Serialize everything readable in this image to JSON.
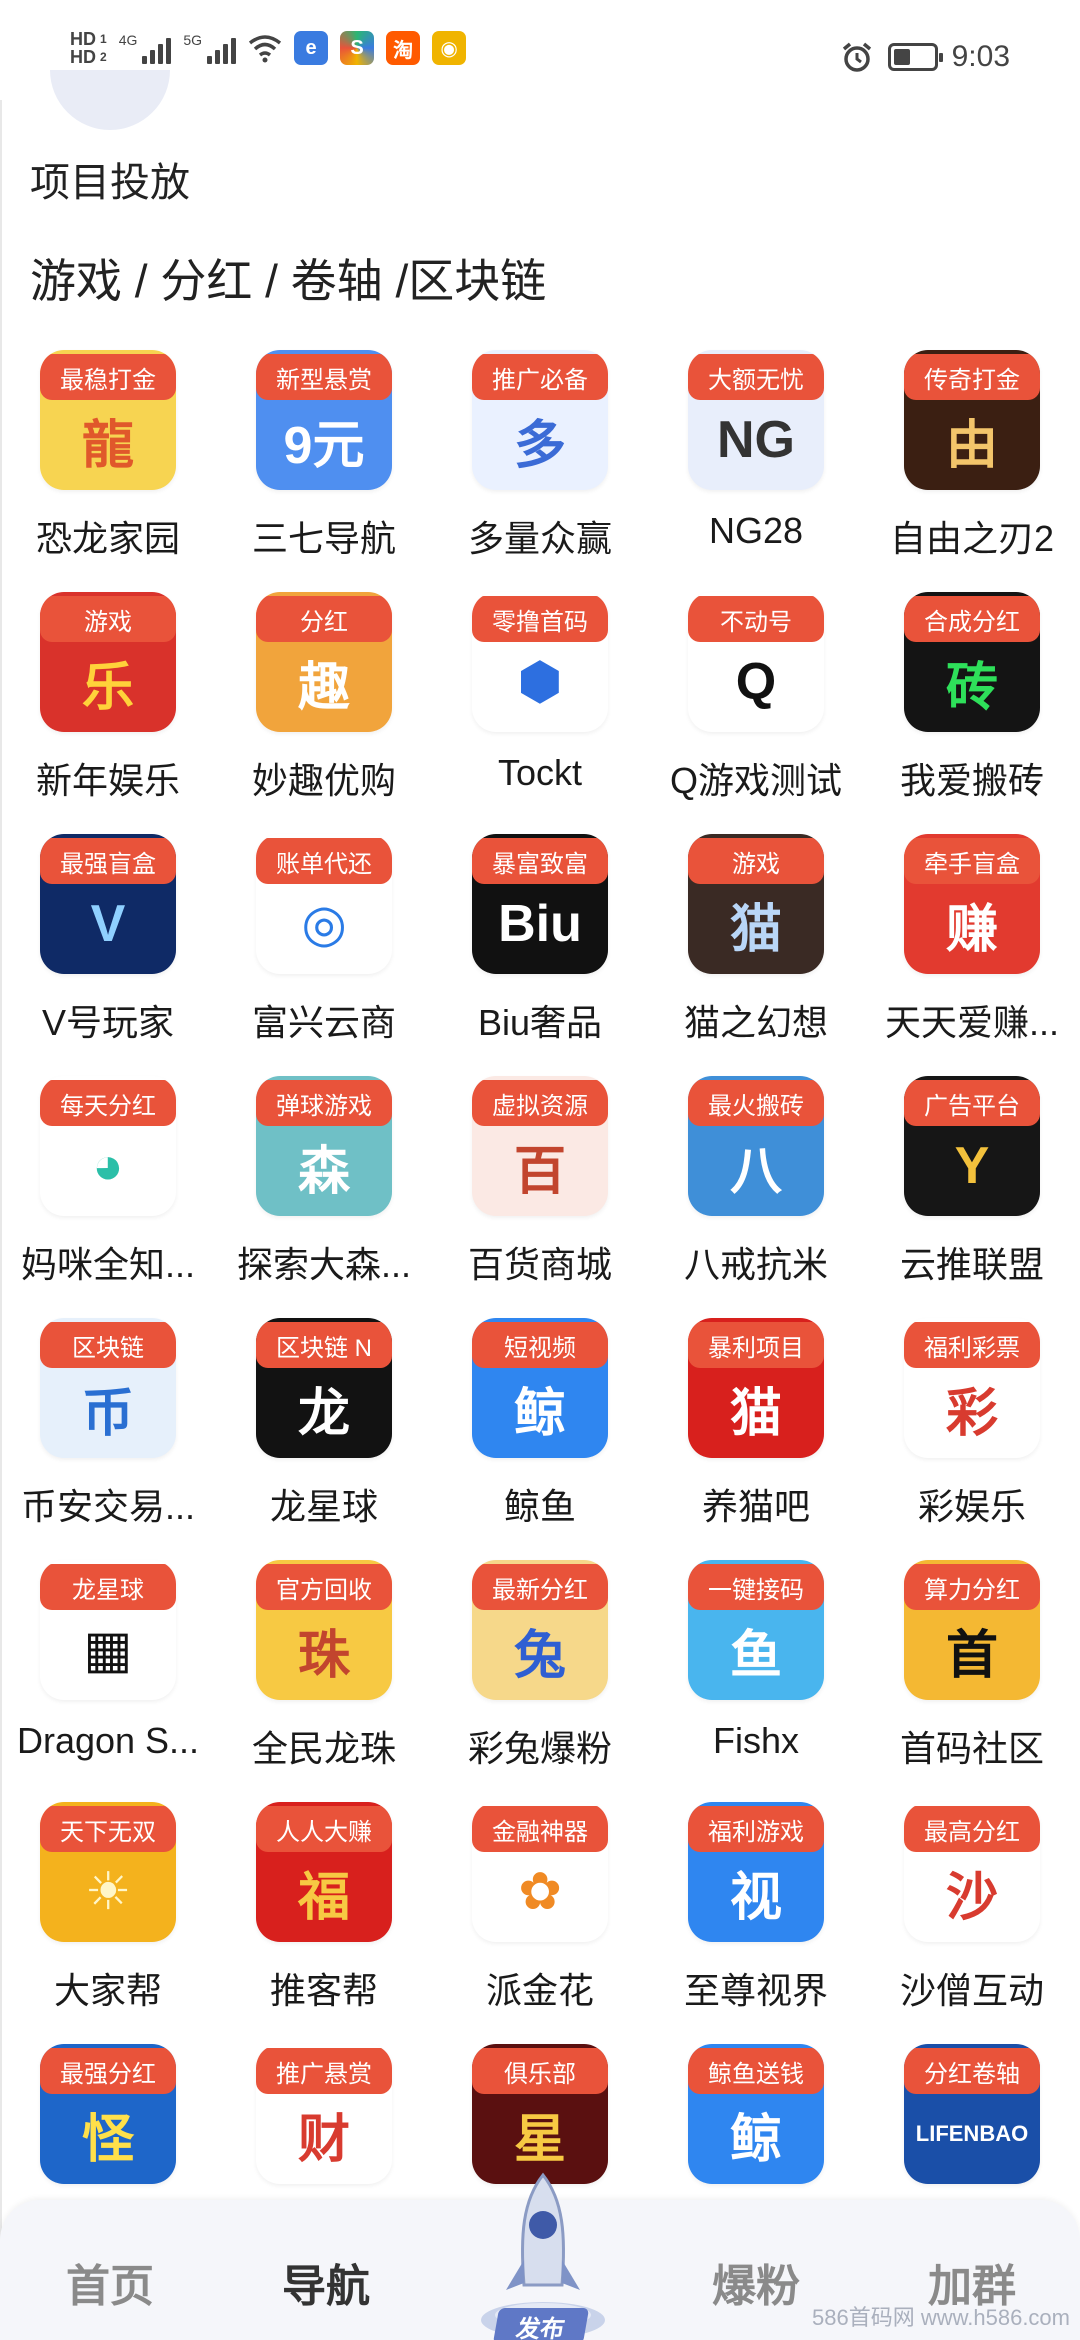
{
  "status_bar": {
    "hd1": "HD",
    "hd2": "HD",
    "net1": "4G",
    "net2": "5G",
    "time": "9:03",
    "apps": [
      {
        "icon": "app-icon-blue",
        "color": "#3a7be0"
      },
      {
        "icon": "app-icon-multicolor",
        "color": "#2bb673"
      },
      {
        "icon": "taobao-icon",
        "text": "淘",
        "color": "#ff5a00"
      },
      {
        "icon": "weibo-icon",
        "color": "#f0b400"
      }
    ]
  },
  "section_title": "项目投放",
  "categories": "游戏 / 分红 / 卷轴 /区块链",
  "items": [
    {
      "badge": "最稳打金",
      "name": "恐龙家园",
      "bg": "#f7d451",
      "fg": "#e0582b",
      "glyph": "龍",
      "icon": "dragon-icon"
    },
    {
      "badge": "新型悬赏",
      "name": "三七导航",
      "bg": "#4f8ff0",
      "fg": "#ffffff",
      "glyph": "9元",
      "icon": "app-icon"
    },
    {
      "badge": "推广必备",
      "name": "多量众赢",
      "bg": "#eaf1ff",
      "fg": "#3b6bd6",
      "glyph": "多",
      "icon": "app-icon"
    },
    {
      "badge": "大额无忧",
      "name": "NG28",
      "bg": "#e8eefb",
      "fg": "#333333",
      "glyph": "NG",
      "icon": "app-icon"
    },
    {
      "badge": "传奇打金",
      "name": "自由之刃2",
      "bg": "#3b1f12",
      "fg": "#f3c56b",
      "glyph": "由",
      "icon": "app-icon"
    },
    {
      "badge": "游戏",
      "name": "新年娱乐",
      "bg": "#d9322b",
      "fg": "#ffd23a",
      "glyph": "乐",
      "icon": "app-icon"
    },
    {
      "badge": "分红",
      "name": "妙趣优购",
      "bg": "#f1a43c",
      "fg": "#ffffff",
      "glyph": "趣",
      "icon": "app-icon"
    },
    {
      "badge": "零撸首码",
      "name": "Tockt",
      "bg": "#ffffff",
      "fg": "#2d6fe0",
      "glyph": "⬢",
      "icon": "hexagon-icon"
    },
    {
      "badge": "不动号",
      "name": "Q游戏测试",
      "bg": "#ffffff",
      "fg": "#111111",
      "glyph": "Q",
      "icon": "penguin-icon"
    },
    {
      "badge": "合成分红",
      "name": "我爱搬砖",
      "bg": "#141414",
      "fg": "#2ee05a",
      "glyph": "砖",
      "icon": "app-icon"
    },
    {
      "badge": "最强盲盒",
      "name": "V号玩家",
      "bg": "#0f2a66",
      "fg": "#8fd0ff",
      "glyph": "V",
      "icon": "app-icon"
    },
    {
      "badge": "账单代还",
      "name": "富兴云商",
      "bg": "#ffffff",
      "fg": "#2a7be6",
      "glyph": "◎",
      "icon": "app-icon"
    },
    {
      "badge": "暴富致富",
      "name": "Biu奢品",
      "bg": "#111111",
      "fg": "#ffffff",
      "glyph": "Biu",
      "icon": "app-icon"
    },
    {
      "badge": "游戏",
      "name": "猫之幻想",
      "bg": "#3a2a24",
      "fg": "#b9d6f7",
      "glyph": "猫",
      "icon": "cat-icon"
    },
    {
      "badge": "牵手盲盒",
      "name": "天天爱赚...",
      "bg": "#e23a2f",
      "fg": "#ffffff",
      "glyph": "赚",
      "icon": "app-icon"
    },
    {
      "badge": "每天分红",
      "name": "妈咪全知...",
      "bg": "#ffffff",
      "fg": "#2bbfa8",
      "glyph": "◕",
      "icon": "bird-icon"
    },
    {
      "badge": "弹球游戏",
      "name": "探索大森...",
      "bg": "#6fc0c6",
      "fg": "#ffffff",
      "glyph": "森",
      "icon": "app-icon"
    },
    {
      "badge": "虚拟资源",
      "name": "百货商城",
      "bg": "#fbe9e4",
      "fg": "#c2452e",
      "glyph": "百",
      "icon": "app-icon"
    },
    {
      "badge": "最火搬砖",
      "name": "八戒抗米",
      "bg": "#3f8fd8",
      "fg": "#ffffff",
      "glyph": "八",
      "icon": "app-icon"
    },
    {
      "badge": "广告平台",
      "name": "云推联盟",
      "bg": "#161616",
      "fg": "#f3c13c",
      "glyph": "Y",
      "icon": "app-icon"
    },
    {
      "badge": "区块链",
      "name": "币安交易...",
      "bg": "#e6f0fb",
      "fg": "#2a6fd2",
      "glyph": "币",
      "icon": "app-icon"
    },
    {
      "badge": "区块链 N",
      "name": "龙星球",
      "bg": "#121212",
      "fg": "#ffffff",
      "glyph": "龙",
      "icon": "app-icon"
    },
    {
      "badge": "短视频",
      "name": "鲸鱼",
      "bg": "#2f86f0",
      "fg": "#ffffff",
      "glyph": "鲸",
      "icon": "app-icon"
    },
    {
      "badge": "暴利项目",
      "name": "养猫吧",
      "bg": "#d8201d",
      "fg": "#ffffff",
      "glyph": "猫",
      "icon": "cat-icon"
    },
    {
      "badge": "福利彩票",
      "name": "彩娱乐",
      "bg": "#ffffff",
      "fg": "#d83b2f",
      "glyph": "彩",
      "icon": "app-icon"
    },
    {
      "badge": "龙星球",
      "name": "Dragon S...",
      "bg": "#ffffff",
      "fg": "#111111",
      "glyph": "▦",
      "icon": "qr-code-icon"
    },
    {
      "badge": "官方回收",
      "name": "全民龙珠",
      "bg": "#f7c943",
      "fg": "#c2452e",
      "glyph": "珠",
      "icon": "app-icon"
    },
    {
      "badge": "最新分红",
      "name": "彩兔爆粉",
      "bg": "#f6d88a",
      "fg": "#2f5fd2",
      "glyph": "兔",
      "icon": "app-icon"
    },
    {
      "badge": "一键接码",
      "name": "Fishx",
      "bg": "#49b5ee",
      "fg": "#ffffff",
      "glyph": "鱼",
      "icon": "fish-icon"
    },
    {
      "badge": "算力分红",
      "name": "首码社区",
      "bg": "#f4b833",
      "fg": "#111111",
      "glyph": "首",
      "icon": "app-icon"
    },
    {
      "badge": "天下无双",
      "name": "大家帮",
      "bg": "#f4b21d",
      "fg": "#fff6c8",
      "glyph": "☀",
      "icon": "sun-icon"
    },
    {
      "badge": "人人大赚",
      "name": "推客帮",
      "bg": "#d8201d",
      "fg": "#f7c943",
      "glyph": "福",
      "icon": "app-icon"
    },
    {
      "badge": "金融神器",
      "name": "派金花",
      "bg": "#ffffff",
      "fg": "#f08a24",
      "glyph": "✿",
      "icon": "flower-icon"
    },
    {
      "badge": "福利游戏",
      "name": "至尊视界",
      "bg": "#2f86f0",
      "fg": "#ffffff",
      "glyph": "视",
      "icon": "app-icon"
    },
    {
      "badge": "最高分红",
      "name": "沙僧互动",
      "bg": "#ffffff",
      "fg": "#d83b2f",
      "glyph": "沙",
      "icon": "app-icon"
    },
    {
      "badge": "最强分红",
      "name": "",
      "bg": "#1e66c9",
      "fg": "#ffe04a",
      "glyph": "怪",
      "icon": "app-icon"
    },
    {
      "badge": "推广悬赏",
      "name": "",
      "bg": "#ffffff",
      "fg": "#d83b2f",
      "glyph": "财",
      "icon": "panda-icon"
    },
    {
      "badge": "俱乐部",
      "name": "",
      "bg": "#5a1010",
      "fg": "#f7c943",
      "glyph": "星",
      "icon": "app-icon"
    },
    {
      "badge": "鲸鱼送钱",
      "name": "",
      "bg": "#2f86f0",
      "fg": "#ffffff",
      "glyph": "鲸",
      "icon": "app-icon"
    },
    {
      "badge": "分红卷轴",
      "name": "",
      "bg": "#1a4fa8",
      "fg": "#ffffff",
      "glyph": "LIFENBAO",
      "icon": "app-icon"
    }
  ],
  "nav": {
    "home": "首页",
    "navigate": "导航",
    "publish": "发布",
    "fans": "爆粉",
    "group": "加群"
  },
  "watermark": "586首码网 www.h586.com"
}
